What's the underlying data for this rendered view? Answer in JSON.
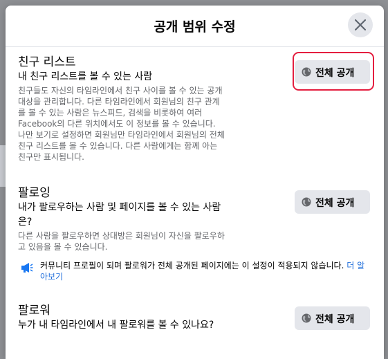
{
  "dialog": {
    "title": "공개 범위 수정",
    "close_icon": "close-icon"
  },
  "sections": [
    {
      "title": "친구 리스트",
      "subtitle": "내 친구 리스트를 볼 수 있는 사람",
      "description": "친구들도 자신의 타임라인에서 친구 사이를 볼 수 있는 공개 대상을 관리합니다. 다른 타임라인에서 회원님의 친구 관계를 볼 수 있는 사람은 뉴스피드, 검색을 비롯하여 여러 Facebook의 다른 위치에서도 이 정보를 볼 수 있습니다. 나만 보기로 설정하면 회원님만 타임라인에서 회원님의 전체 친구 리스트를 볼 수 있습니다. 다른 사람에게는 함께 아는 친구만 표시됩니다.",
      "audience": "전체 공개"
    },
    {
      "title": "팔로잉",
      "subtitle": "내가 팔로우하는 사람 및 페이지를 볼 수 있는 사람은?",
      "description": "다른 사람을 팔로우하면 상대방은 회원님이 자신을 팔로우하고 있음을 볼 수 있습니다.",
      "audience": "전체 공개"
    },
    {
      "title": "팔로워",
      "subtitle": "누가 내 타임라인에서 내 팔로워를 볼 수 있나요?",
      "audience": "전체 공개"
    }
  ],
  "notice": {
    "icon": "megaphone-icon",
    "text": "커뮤니티 프로필이 되며 팔로워가 전체 공개된 페이지에는 이 설정이 적용되지 않습니다.",
    "link": "더 알아보기"
  },
  "colors": {
    "highlight": "#e41e3f",
    "button_bg": "#e4e6eb",
    "link": "#216fdb",
    "secondary_text": "#65676b"
  }
}
